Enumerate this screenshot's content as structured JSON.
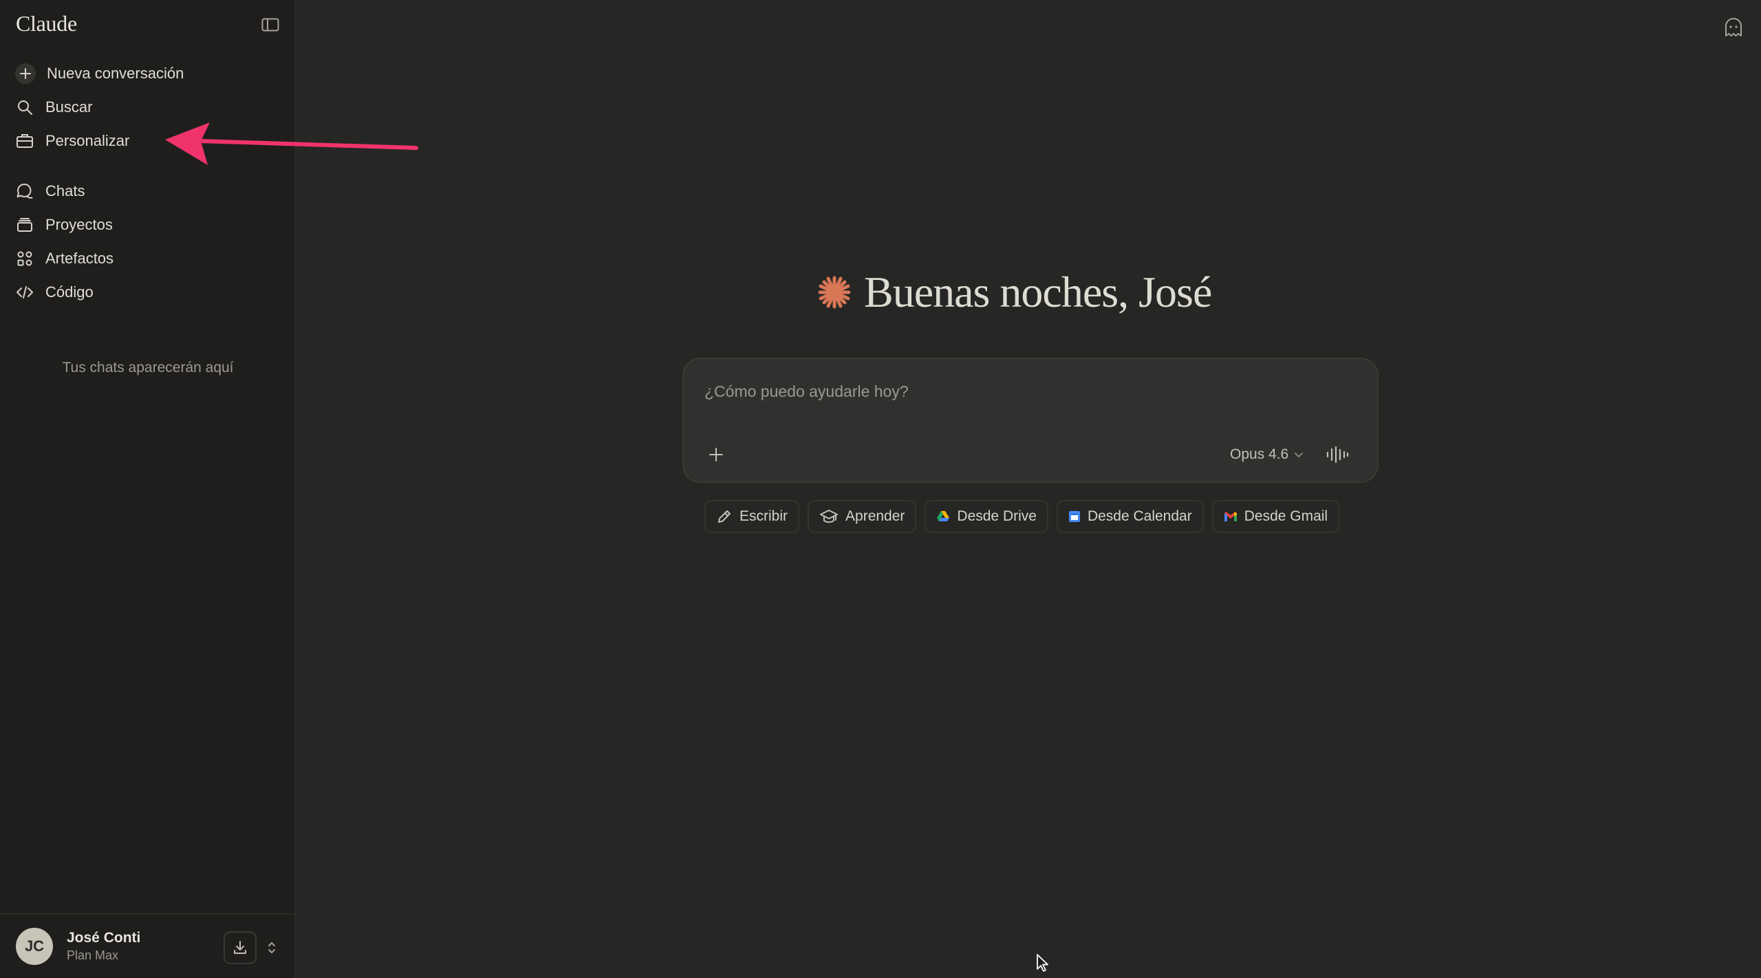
{
  "sidebar": {
    "brand": "Claude",
    "nav_primary": [
      {
        "label": "Nueva conversación",
        "icon": "plus-icon"
      },
      {
        "label": "Buscar",
        "icon": "search-icon"
      },
      {
        "label": "Personalizar",
        "icon": "briefcase-icon"
      }
    ],
    "nav_secondary": [
      {
        "label": "Chats",
        "icon": "chat-bubbles-icon"
      },
      {
        "label": "Proyectos",
        "icon": "folder-stack-icon"
      },
      {
        "label": "Artefactos",
        "icon": "artifacts-grid-icon"
      },
      {
        "label": "Código",
        "icon": "code-icon"
      }
    ],
    "empty_hint": "Tus chats aparecerán aquí",
    "user": {
      "initials": "JC",
      "name": "José Conti",
      "plan": "Plan Max"
    }
  },
  "main": {
    "greeting": "Buenas noches, José",
    "composer": {
      "placeholder": "¿Cómo puedo ayudarle hoy?",
      "model": "Opus 4.6"
    },
    "chips": [
      {
        "label": "Escribir",
        "icon": "pencil-icon"
      },
      {
        "label": "Aprender",
        "icon": "graduation-cap-icon"
      },
      {
        "label": "Desde Drive",
        "icon": "drive-icon"
      },
      {
        "label": "Desde Calendar",
        "icon": "calendar-icon"
      },
      {
        "label": "Desde Gmail",
        "icon": "gmail-icon"
      }
    ]
  },
  "colors": {
    "background": "#262624",
    "sidebar": "#1f1e1d",
    "accent": "#d97757",
    "annotation": "#f0336b"
  }
}
